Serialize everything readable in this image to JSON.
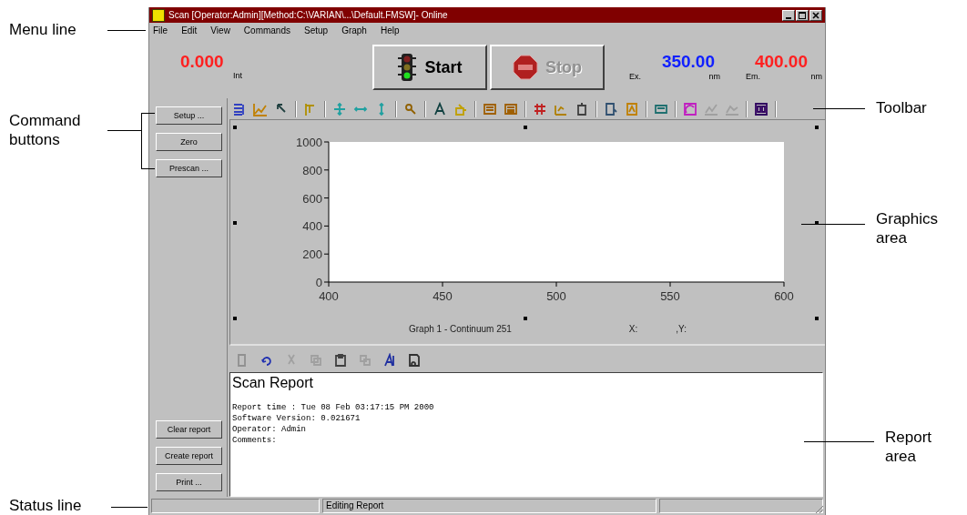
{
  "window": {
    "title": "Scan [Operator:Admin][Method:C:\\VARIAN\\...\\Default.FMSW]- Online"
  },
  "menu": [
    "File",
    "Edit",
    "View",
    "Commands",
    "Setup",
    "Graph",
    "Help"
  ],
  "readouts": {
    "intensity": {
      "value": "0.000",
      "unit": "Int"
    },
    "excitation": {
      "value": "350.00",
      "label": "Ex.",
      "unit": "nm"
    },
    "emission": {
      "value": "400.00",
      "label": "Em.",
      "unit": "nm"
    }
  },
  "start_button": {
    "label": "Start",
    "disabled": false
  },
  "stop_button": {
    "label": "Stop",
    "disabled": true
  },
  "command_buttons": [
    "Setup ...",
    "Zero",
    "Prescan ..."
  ],
  "report_buttons": [
    "Clear report",
    "Create report",
    "Print ..."
  ],
  "graph": {
    "caption": "Graph 1 - Continuum 251",
    "x_readout": "X:",
    "y_readout": ",Y:",
    "chart_data": {
      "type": "line",
      "xlim": [
        400,
        600
      ],
      "ylim": [
        0,
        1000
      ],
      "xticks": [
        400,
        450,
        500,
        550,
        600
      ],
      "yticks": [
        0,
        200,
        400,
        600,
        800,
        1000
      ]
    }
  },
  "report": {
    "title": "Scan Report",
    "lines": [
      "Report time : Tue 08 Feb 03:17:15 PM 2000",
      "Software Version: 0.021671",
      "Operator: Admin",
      "Comments:"
    ]
  },
  "status_bar": {
    "message": "Editing Report"
  },
  "annotations": [
    {
      "lines": [
        "Menu line"
      ]
    },
    {
      "lines": [
        "Command",
        "buttons"
      ]
    },
    {
      "lines": [
        "Status line"
      ]
    },
    {
      "lines": [
        "Toolbar"
      ]
    },
    {
      "lines": [
        "Graphics",
        "area"
      ]
    },
    {
      "lines": [
        "Report",
        "area"
      ]
    }
  ]
}
